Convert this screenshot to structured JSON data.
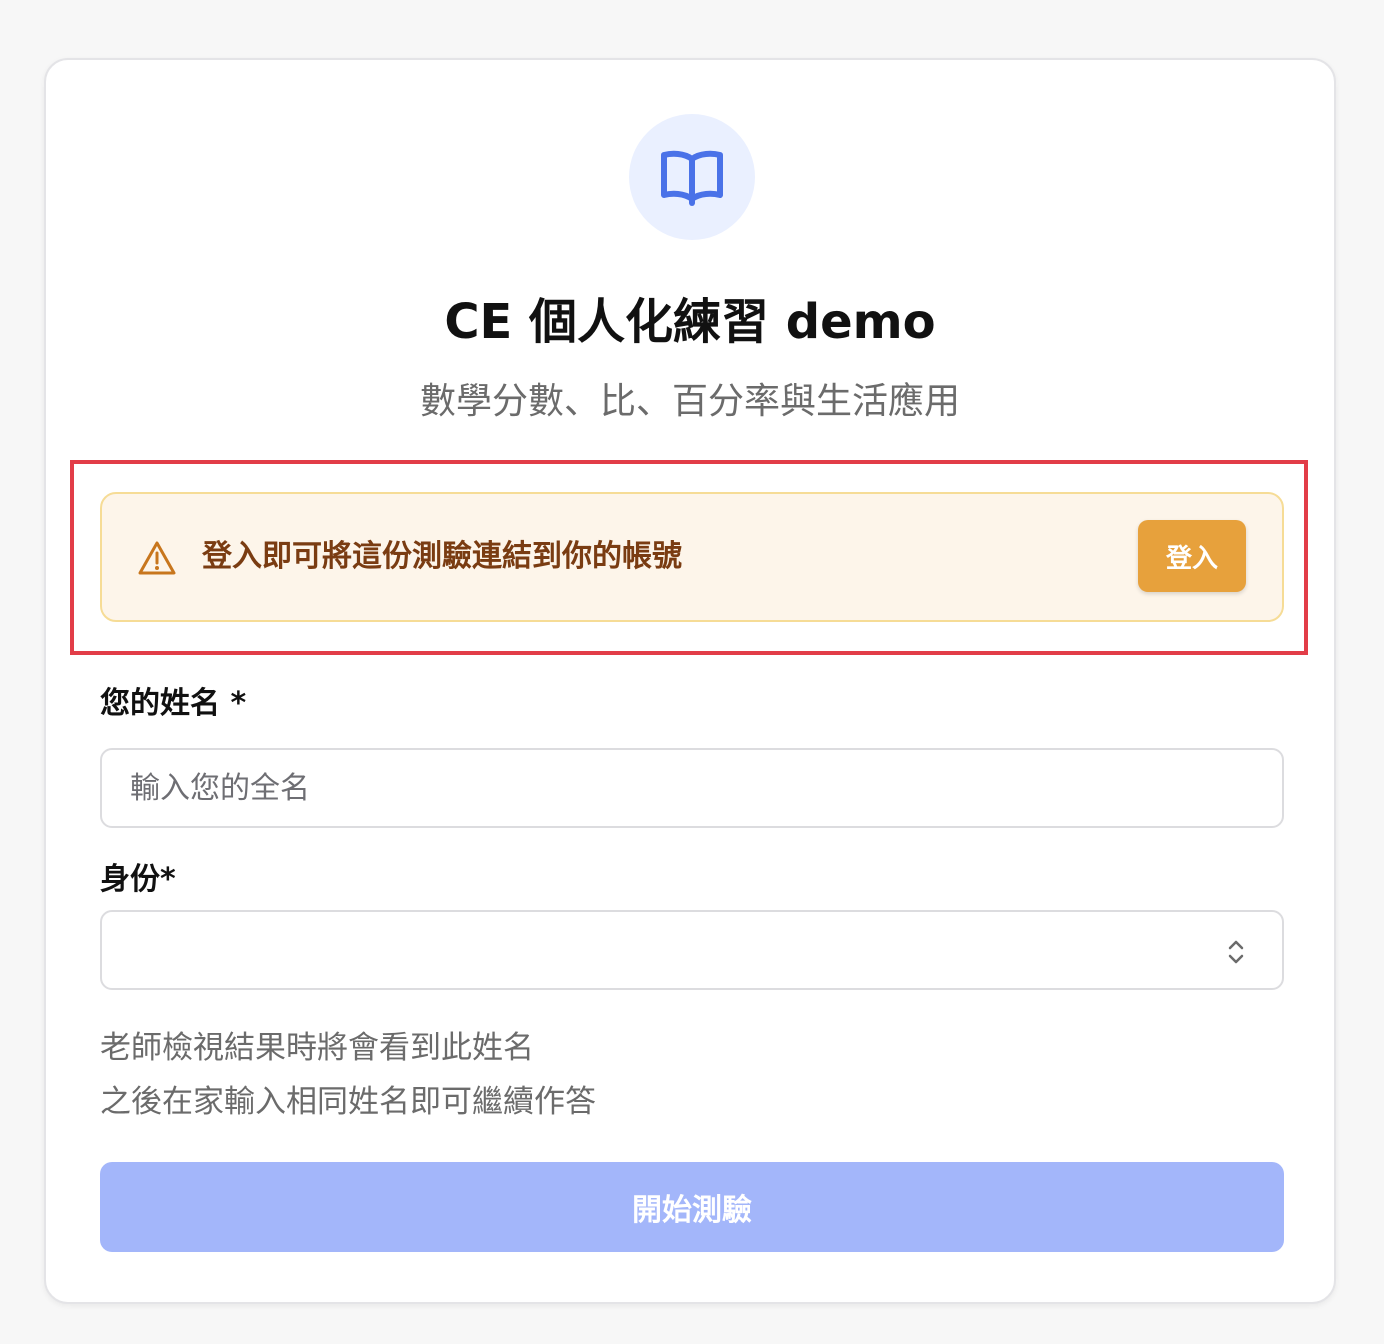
{
  "header": {
    "logo_icon": "open-book-icon",
    "title": "CE 個人化練習 demo",
    "subtitle": "數學分數、比、百分率與生活應用"
  },
  "login_banner": {
    "icon": "warning-triangle-icon",
    "message": "登入即可將這份測驗連結到你的帳號",
    "button_label": "登入",
    "highlight_color": "#e23d48",
    "background_color": "#fdf5ea",
    "button_color": "#e7a13c"
  },
  "form": {
    "name_label": "您的姓名 *",
    "name_placeholder": "輸入您的全名",
    "name_value": "",
    "role_label": "身份*",
    "role_value": "",
    "role_icon": "up-down-chevron-icon",
    "hint_line1": "老師檢視結果時將會看到此姓名",
    "hint_line2": "之後在家輸入相同姓名即可繼續作答",
    "start_button_label": "開始測驗",
    "start_button_color": "#a3b6fa",
    "accent_color": "#4a72e8"
  }
}
